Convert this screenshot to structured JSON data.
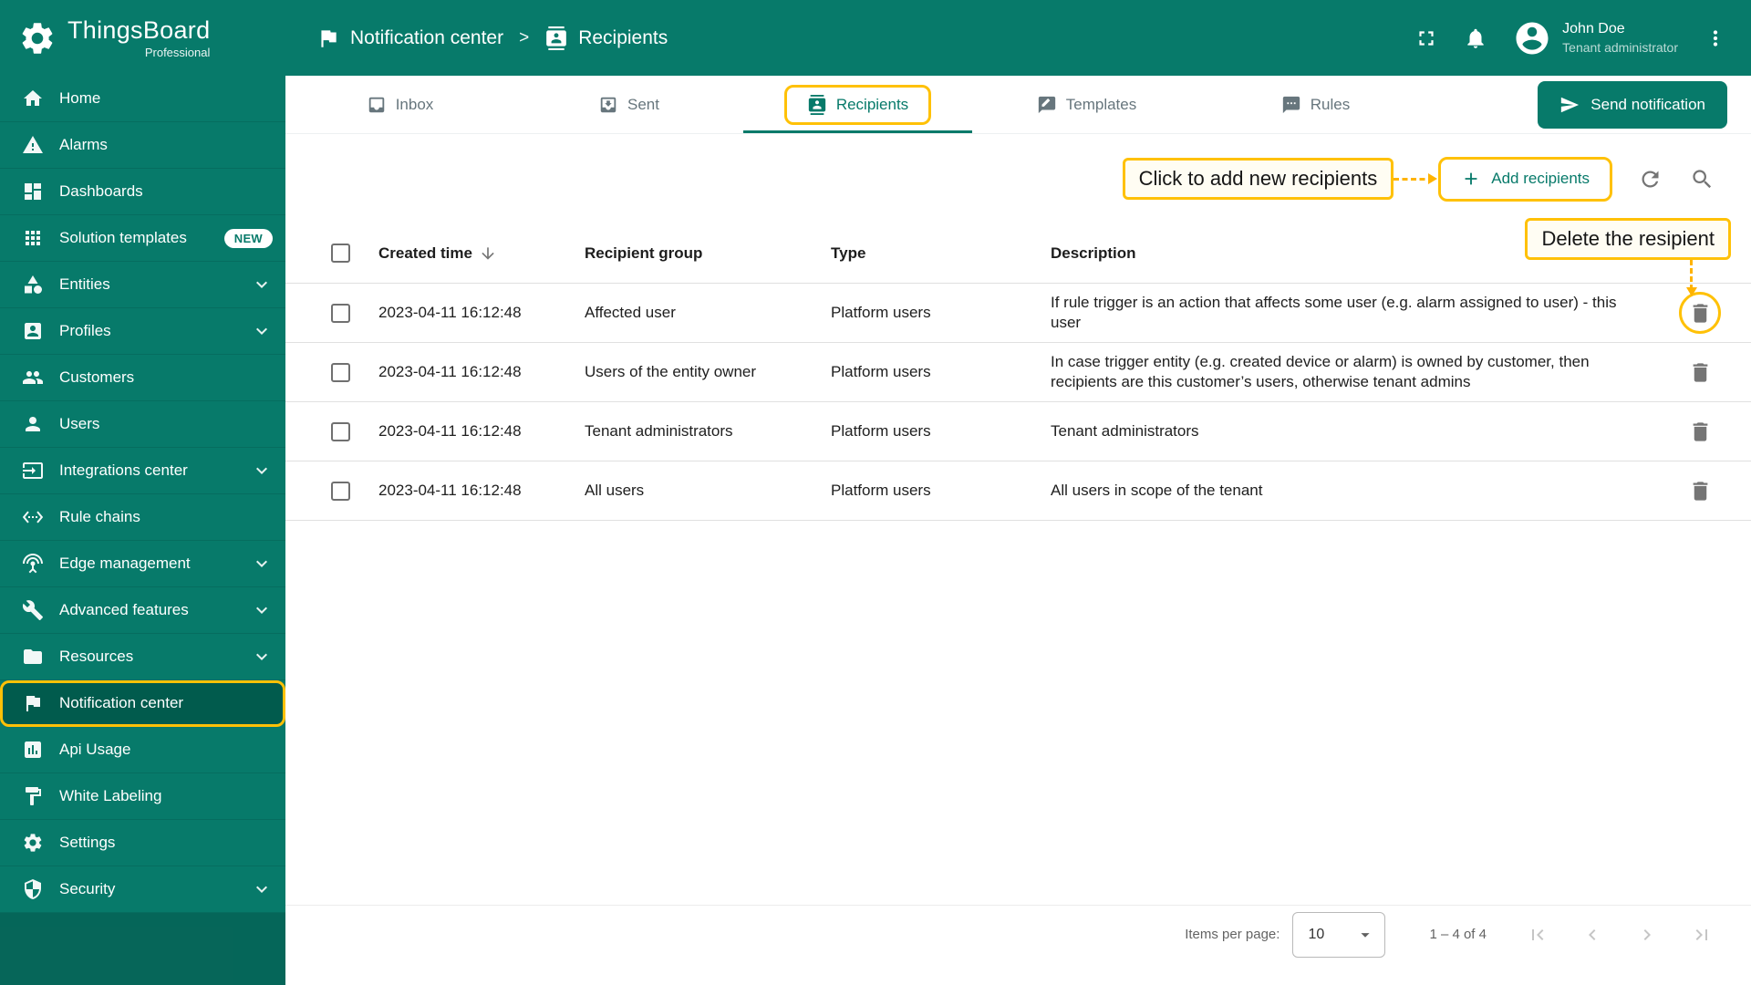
{
  "colors": {
    "primary": "#077A6A",
    "primary_dark": "#015B4D",
    "accent": "#FFC107",
    "icon_gray": "#757575"
  },
  "brand": {
    "name": "ThingsBoard",
    "subtitle": "Professional"
  },
  "topbar": {
    "breadcrumb": {
      "parent": "Notification center",
      "separator": ">",
      "current": "Recipients"
    },
    "user": {
      "name": "John Doe",
      "role": "Tenant administrator"
    }
  },
  "sidebar": {
    "items": [
      {
        "label": "Home",
        "icon": "home-icon"
      },
      {
        "label": "Alarms",
        "icon": "alarms-icon"
      },
      {
        "label": "Dashboards",
        "icon": "dashboards-icon"
      },
      {
        "label": "Solution templates",
        "icon": "solution-templates-icon",
        "badge": "NEW"
      },
      {
        "label": "Entities",
        "icon": "entities-icon",
        "expandable": true
      },
      {
        "label": "Profiles",
        "icon": "profiles-icon",
        "expandable": true
      },
      {
        "label": "Customers",
        "icon": "customers-icon"
      },
      {
        "label": "Users",
        "icon": "users-icon"
      },
      {
        "label": "Integrations center",
        "icon": "integrations-icon",
        "expandable": true
      },
      {
        "label": "Rule chains",
        "icon": "rule-chains-icon"
      },
      {
        "label": "Edge management",
        "icon": "edge-management-icon",
        "expandable": true
      },
      {
        "label": "Advanced features",
        "icon": "advanced-features-icon",
        "expandable": true
      },
      {
        "label": "Resources",
        "icon": "resources-icon",
        "expandable": true
      },
      {
        "label": "Notification center",
        "icon": "notification-center-icon",
        "active": true
      },
      {
        "label": "Api Usage",
        "icon": "api-usage-icon"
      },
      {
        "label": "White Labeling",
        "icon": "white-labeling-icon"
      },
      {
        "label": "Settings",
        "icon": "settings-icon"
      },
      {
        "label": "Security",
        "icon": "security-icon",
        "expandable": true
      }
    ]
  },
  "tabs": [
    {
      "label": "Inbox",
      "icon": "inbox-icon"
    },
    {
      "label": "Sent",
      "icon": "sent-icon"
    },
    {
      "label": "Recipients",
      "icon": "recipients-icon",
      "active": true
    },
    {
      "label": "Templates",
      "icon": "templates-icon"
    },
    {
      "label": "Rules",
      "icon": "rules-icon"
    }
  ],
  "toolbar": {
    "send_notification_label": "Send notification",
    "add_recipients_label": "Add recipients"
  },
  "annotations": {
    "add_recipients": "Click to add new recipients",
    "delete_recipient": "Delete the resipient"
  },
  "table": {
    "columns": {
      "created_time": "Created time",
      "recipient_group": "Recipient group",
      "type": "Type",
      "description": "Description"
    },
    "rows": [
      {
        "created_time": "2023-04-11 16:12:48",
        "recipient_group": "Affected user",
        "type": "Platform users",
        "description": "If rule trigger is an action that affects some user (e.g. alarm assigned to user) - this user"
      },
      {
        "created_time": "2023-04-11 16:12:48",
        "recipient_group": "Users of the entity owner",
        "type": "Platform users",
        "description": "In case trigger entity (e.g. created device or alarm) is owned by customer, then recipients are this customer’s users, otherwise tenant admins"
      },
      {
        "created_time": "2023-04-11 16:12:48",
        "recipient_group": "Tenant administrators",
        "type": "Platform users",
        "description": "Tenant administrators"
      },
      {
        "created_time": "2023-04-11 16:12:48",
        "recipient_group": "All users",
        "type": "Platform users",
        "description": "All users in scope of the tenant"
      }
    ]
  },
  "pagination": {
    "items_per_page_label": "Items per page:",
    "items_per_page_value": "10",
    "range": "1 – 4 of 4"
  }
}
